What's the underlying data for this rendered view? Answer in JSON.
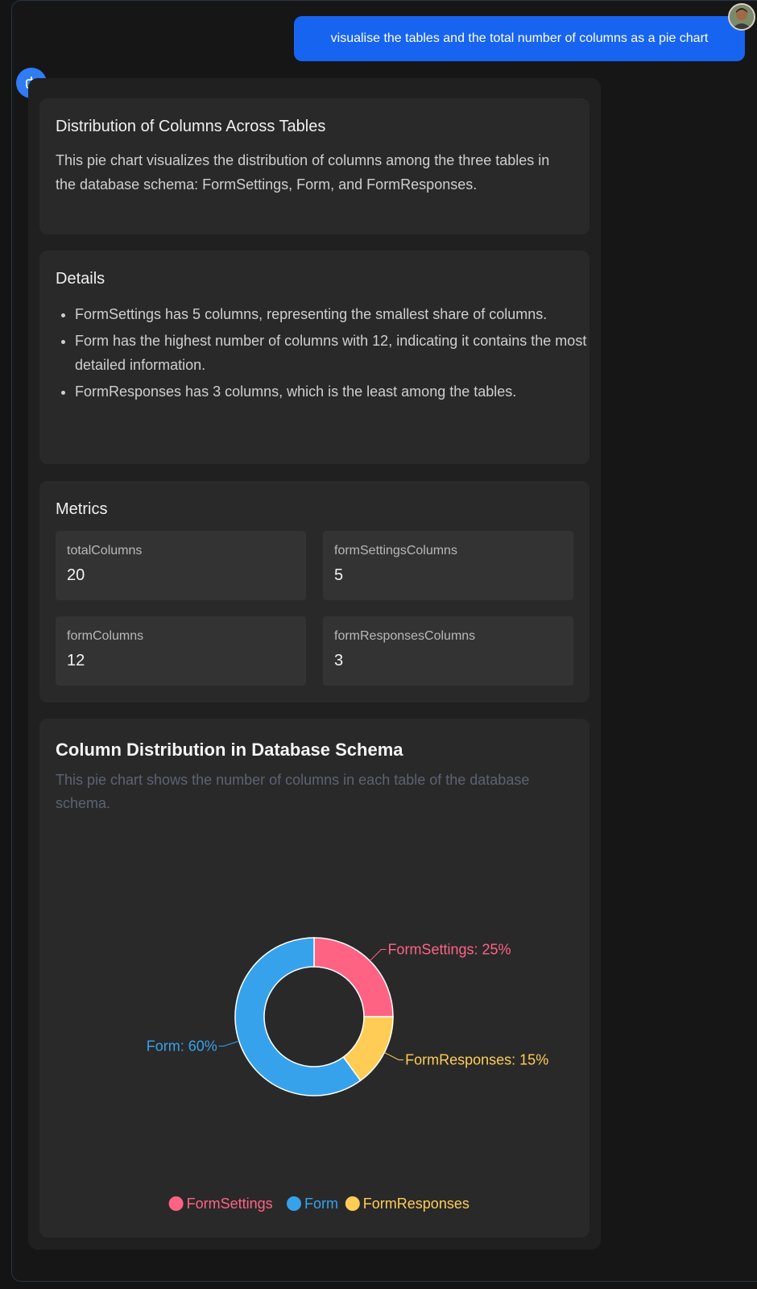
{
  "conversation": {
    "user_message": "visualise the tables and the total number of columns as a pie chart"
  },
  "summary_card": {
    "title": "Distribution of Columns Across Tables",
    "body": "This pie chart visualizes the distribution of columns among the three tables in the database schema: FormSettings, Form, and FormResponses."
  },
  "details_card": {
    "title": "Details",
    "items": [
      "FormSettings has 5 columns, representing the smallest share of columns.",
      "Form has the highest number of columns with 12, indicating it contains the most detailed information.",
      "FormResponses has 3 columns, which is the least among the tables."
    ]
  },
  "metrics_card": {
    "title": "Metrics",
    "metrics": [
      {
        "label": "totalColumns",
        "value": "20"
      },
      {
        "label": "formSettingsColumns",
        "value": "5"
      },
      {
        "label": "formColumns",
        "value": "12"
      },
      {
        "label": "formResponsesColumns",
        "value": "3"
      }
    ]
  },
  "chart_card": {
    "title": "Column Distribution in Database Schema",
    "description": "This pie chart shows the number of columns in each table of the database schema."
  },
  "chart_data": {
    "type": "pie",
    "donut": true,
    "title": "Column Distribution in Database Schema",
    "categories": [
      "FormSettings",
      "Form",
      "FormResponses"
    ],
    "values": [
      5,
      12,
      3
    ],
    "percent_labels": [
      "FormSettings: 25%",
      "Form: 60%",
      "FormResponses: 15%"
    ],
    "colors": [
      "#ff6384",
      "#36a2eb",
      "#ffcd56"
    ],
    "legend_position": "bottom",
    "slice_order": [
      "FormSettings",
      "FormResponses",
      "Form"
    ]
  },
  "icons": {
    "assistant": "robot-icon",
    "user": "user-avatar"
  }
}
